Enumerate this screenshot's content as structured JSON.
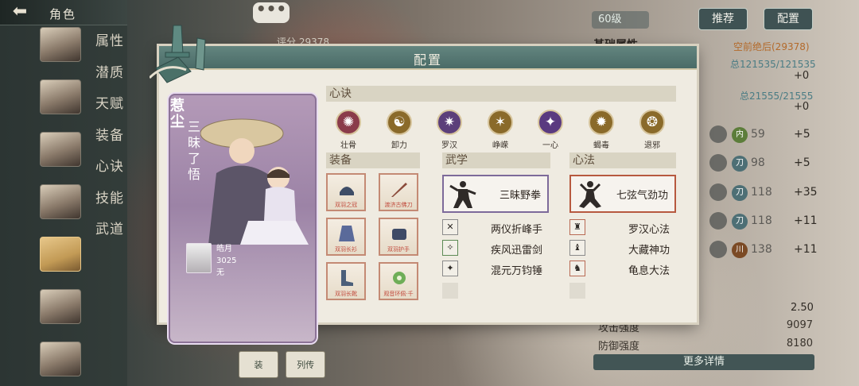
{
  "topbar": {
    "title": "角色"
  },
  "side_menu": [
    "属性",
    "潜质",
    "天赋",
    "装备",
    "心诀",
    "技能",
    "武道"
  ],
  "score_label": "评分 29378",
  "level": "60级",
  "top_buttons": {
    "recommend": "推荐",
    "config": "配置"
  },
  "right_panel": {
    "basic_attr": "基础属性",
    "power": "空前绝后(29378)",
    "hp": "总121535/121535",
    "hp_plus": "+0",
    "mp": "总21555/21555",
    "mp_plus": "+0",
    "stats": [
      {
        "badge": "内",
        "value": "59",
        "plus": "+5",
        "color": "green"
      },
      {
        "badge": "刀",
        "value": "98",
        "plus": "+5",
        "color": "teal"
      },
      {
        "badge": "刀",
        "value": "118",
        "plus": "+35",
        "color": "teal"
      },
      {
        "badge": "刀",
        "value": "118",
        "plus": "+11",
        "color": "teal"
      },
      {
        "badge": "川",
        "value": "138",
        "plus": "+11",
        "color": "bronze"
      }
    ],
    "crit_value": "2.50",
    "attack_label": "攻击强度",
    "attack_value": "9097",
    "defense_label": "防御强度",
    "defense_value": "8180",
    "more": "更多详情"
  },
  "bottom_tabs": [
    "装",
    "列传"
  ],
  "dialog": {
    "title": "配置",
    "character": {
      "name": "惹尘",
      "title": "三昧了悟",
      "pet_name": "皓月",
      "pet_power": "3025",
      "pet_extra": "无"
    },
    "xinjue_label": "心诀",
    "xinjue": [
      {
        "name": "壮骨",
        "glyph": "✺",
        "color": "#8a3b4a"
      },
      {
        "name": "卸力",
        "glyph": "☯",
        "color": "#8a6a2a"
      },
      {
        "name": "罗汉",
        "glyph": "✷",
        "color": "#5c3f7a"
      },
      {
        "name": "峥嵘",
        "glyph": "✶",
        "color": "#8a6a2a"
      },
      {
        "name": "一心",
        "glyph": "✦",
        "color": "#5a3a80"
      },
      {
        "name": "蝎毒",
        "glyph": "✹",
        "color": "#8a6a2a"
      },
      {
        "name": "退邪",
        "glyph": "❂",
        "color": "#8a6a2a"
      }
    ],
    "equip_label": "装备",
    "equipment": [
      "双羽之冠",
      "渡济古佛刀",
      "双羽长衫",
      "双羽护手",
      "双羽长靴",
      "观音环佩·千"
    ],
    "wuxue_label": "武学",
    "wuxue_main": "三昧野拳",
    "wuxue_list": [
      "两仪折峰手",
      "疾风迅雷剑",
      "混元万钧锤"
    ],
    "xinfa_label": "心法",
    "xinfa_main": "七弦气劲功",
    "xinfa_list": [
      "罗汉心法",
      "大藏神功",
      "龟息大法"
    ]
  }
}
